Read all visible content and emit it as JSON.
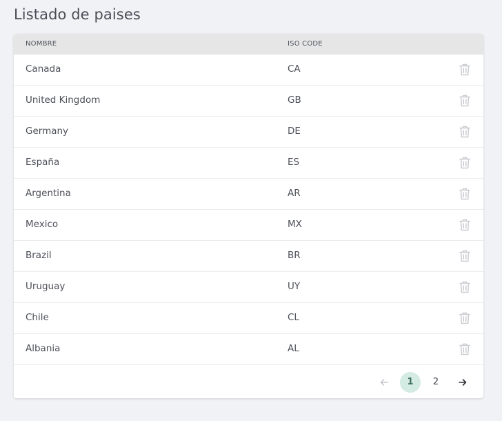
{
  "page": {
    "title": "Listado de paises"
  },
  "table": {
    "columns": {
      "name": "NOMBRE",
      "iso": "ISO CODE"
    },
    "rows": [
      {
        "name": "Canada",
        "iso": "CA"
      },
      {
        "name": "United Kingdom",
        "iso": "GB"
      },
      {
        "name": "Germany",
        "iso": "DE"
      },
      {
        "name": "España",
        "iso": "ES"
      },
      {
        "name": "Argentina",
        "iso": "AR"
      },
      {
        "name": "Mexico",
        "iso": "MX"
      },
      {
        "name": "Brazil",
        "iso": "BR"
      },
      {
        "name": "Uruguay",
        "iso": "UY"
      },
      {
        "name": "Chile",
        "iso": "CL"
      },
      {
        "name": "Albania",
        "iso": "AL"
      }
    ],
    "row_action_icon": "trash-icon"
  },
  "pagination": {
    "prev_icon": "arrow-left-icon",
    "pages": [
      "1",
      "2"
    ],
    "current": "1",
    "next_icon": "arrow-right-icon"
  },
  "colors": {
    "background": "#f1f2f6",
    "header_bg": "#e6e6e7",
    "active_page_bg": "#d4ebe3",
    "icon_muted": "#c9cbd0"
  }
}
